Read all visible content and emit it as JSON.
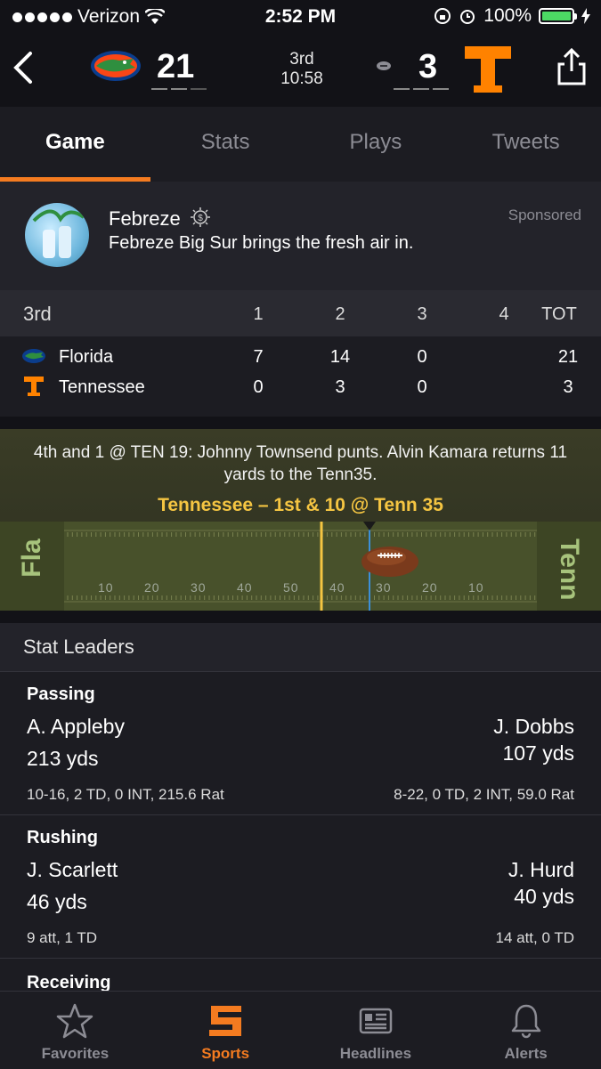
{
  "status_bar": {
    "carrier": "Verizon",
    "time": "2:52 PM",
    "battery": "100%"
  },
  "header": {
    "home_score": "21",
    "away_score": "3",
    "quarter": "3rd",
    "clock": "10:58"
  },
  "tabs": [
    {
      "label": "Game"
    },
    {
      "label": "Stats"
    },
    {
      "label": "Plays"
    },
    {
      "label": "Tweets"
    }
  ],
  "ad": {
    "title": "Febreze",
    "body": "Febreze Big Sur brings the fresh air in.",
    "sponsored": "Sponsored"
  },
  "linescore": {
    "period_label": "3rd",
    "headers": [
      "1",
      "2",
      "3",
      "4",
      "TOT"
    ],
    "teams": [
      {
        "name": "Florida",
        "q1": "7",
        "q2": "14",
        "q3": "0",
        "q4": "",
        "tot": "21"
      },
      {
        "name": "Tennessee",
        "q1": "0",
        "q2": "3",
        "q3": "0",
        "q4": "",
        "tot": "3"
      }
    ]
  },
  "play": {
    "description": "4th and 1 @ TEN 19: Johnny Townsend punts. Alvin Kamara returns 11 yards to the Tenn35.",
    "down_distance": "Tennessee – 1st & 10 @ Tenn 35",
    "left_endzone": "Fla",
    "right_endzone": "Tenn",
    "yard_labels": [
      "10",
      "20",
      "30",
      "40",
      "50",
      "40",
      "30",
      "20",
      "10"
    ]
  },
  "stat_leaders": {
    "title": "Stat Leaders",
    "categories": [
      {
        "name": "Passing",
        "left": {
          "player": "A. Appleby",
          "yds": "213 yds",
          "detail": "10-16, 2 TD, 0 INT, 215.6 Rat"
        },
        "right": {
          "player": "J. Dobbs",
          "yds": "107 yds",
          "detail": "8-22, 0 TD, 2 INT, 59.0 Rat"
        }
      },
      {
        "name": "Rushing",
        "left": {
          "player": "J. Scarlett",
          "yds": "46 yds",
          "detail": "9 att, 1 TD"
        },
        "right": {
          "player": "J. Hurd",
          "yds": "40 yds",
          "detail": "14 att, 0 TD"
        }
      },
      {
        "name": "Receiving"
      }
    ]
  },
  "nav": [
    {
      "label": "Favorites"
    },
    {
      "label": "Sports"
    },
    {
      "label": "Headlines"
    },
    {
      "label": "Alerts"
    }
  ],
  "colors": {
    "accent": "#f47b20",
    "background": "#121217",
    "down_text": "#f5c542"
  }
}
